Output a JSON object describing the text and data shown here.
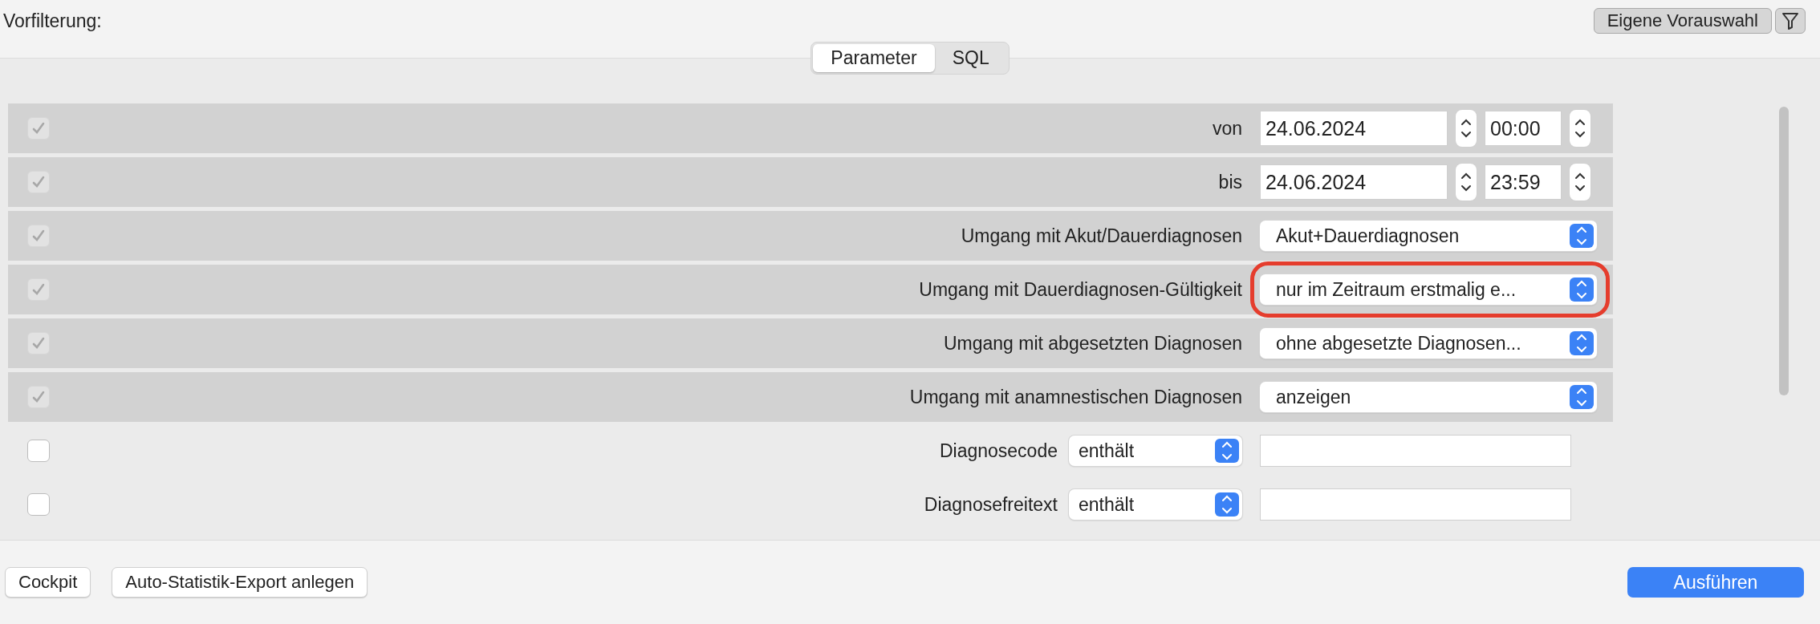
{
  "header": {
    "title": "Vorfilterung:",
    "preset_button": "Eigene Vorauswahl"
  },
  "tabs": [
    {
      "label": "Parameter",
      "selected": true
    },
    {
      "label": "SQL",
      "selected": false
    }
  ],
  "rows": [
    {
      "kind": "datetime",
      "checked": true,
      "label": "von",
      "date": "24.06.2024",
      "time": "00:00"
    },
    {
      "kind": "datetime",
      "checked": true,
      "label": "bis",
      "date": "24.06.2024",
      "time": "23:59"
    },
    {
      "kind": "select",
      "checked": true,
      "label": "Umgang mit Akut/Dauerdiagnosen",
      "value": "Akut+Dauerdiagnosen",
      "highlighted": false
    },
    {
      "kind": "select",
      "checked": true,
      "label": "Umgang mit Dauerdiagnosen-Gültigkeit",
      "value": "nur im Zeitraum erstmalig e...",
      "highlighted": true
    },
    {
      "kind": "select",
      "checked": true,
      "label": "Umgang mit abgesetzten Diagnosen",
      "value": "ohne abgesetzte Diagnosen...",
      "highlighted": false
    },
    {
      "kind": "select",
      "checked": true,
      "label": "Umgang mit anamnestischen Diagnosen",
      "value": "anzeigen",
      "highlighted": false
    },
    {
      "kind": "filter",
      "checked": false,
      "label": "Diagnosecode",
      "operator": "enthält"
    },
    {
      "kind": "filter",
      "checked": false,
      "label": "Diagnosefreitext",
      "operator": "enthält"
    }
  ],
  "footer": {
    "left_buttons": [
      "Cockpit",
      "Auto-Statistik-Export anlegen"
    ],
    "primary_button": "Ausführen"
  }
}
